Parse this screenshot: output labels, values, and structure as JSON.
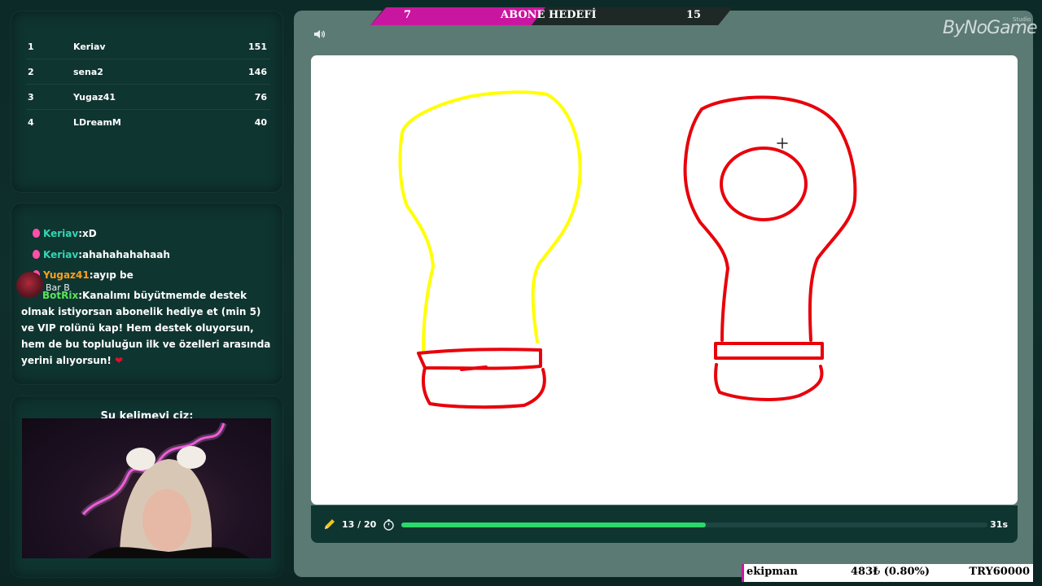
{
  "leaderboard": [
    {
      "rank": "1",
      "name": "Keriav",
      "score": "151"
    },
    {
      "rank": "2",
      "name": "sena2",
      "score": "146"
    },
    {
      "rank": "3",
      "name": "Yugaz41",
      "score": "76"
    },
    {
      "rank": "4",
      "name": "LDreamM",
      "score": "40"
    }
  ],
  "chat": [
    {
      "user": "Keriav",
      "sep": ":",
      "text": "xD",
      "color": "#33d6b3"
    },
    {
      "user": "Keriav",
      "sep": ":",
      "text": "ahahahahahaah",
      "color": "#33d6b3"
    },
    {
      "user": "Yugaz41",
      "sep": ":",
      "text": "ayıp be",
      "color": "#ff9f1a"
    },
    {
      "user": "BotRix",
      "sep": ":",
      "text": "Kanalımı büyütmemde destek olmak istiyorsan abonelik hediye et (min 5) ve VIP rolünü kap! Hem destek oluyorsun, hem de bu topluluğun ilk ve özelleri arasında yerini alıyorsun!",
      "emoji": "❤",
      "color": "#5be35b"
    }
  ],
  "overlay_name": "Bar B",
  "word_prompt": "Şu kelimeyi çiz:",
  "sub_goal": {
    "title": "ABONE HEDEFİ",
    "current": "7",
    "target": "15"
  },
  "logo": {
    "text": "ByNoGame",
    "sub": "Studio"
  },
  "round": {
    "label": "13 / 20",
    "current": 13,
    "total": 20
  },
  "timer": {
    "label": "31s",
    "progress": 0.52
  },
  "ticker": {
    "user": "ekipman",
    "amount": "483₺ (0.80%)",
    "goal": "TRY60000"
  },
  "icons": {
    "volume": "volume-icon",
    "pencil": "pencil-icon",
    "stopwatch": "stopwatch-icon"
  },
  "colors": {
    "accent_green": "#2bd96b",
    "goal_pink": "#c916a0",
    "ink_yellow": "#ffff00",
    "ink_red": "#e8000b"
  }
}
